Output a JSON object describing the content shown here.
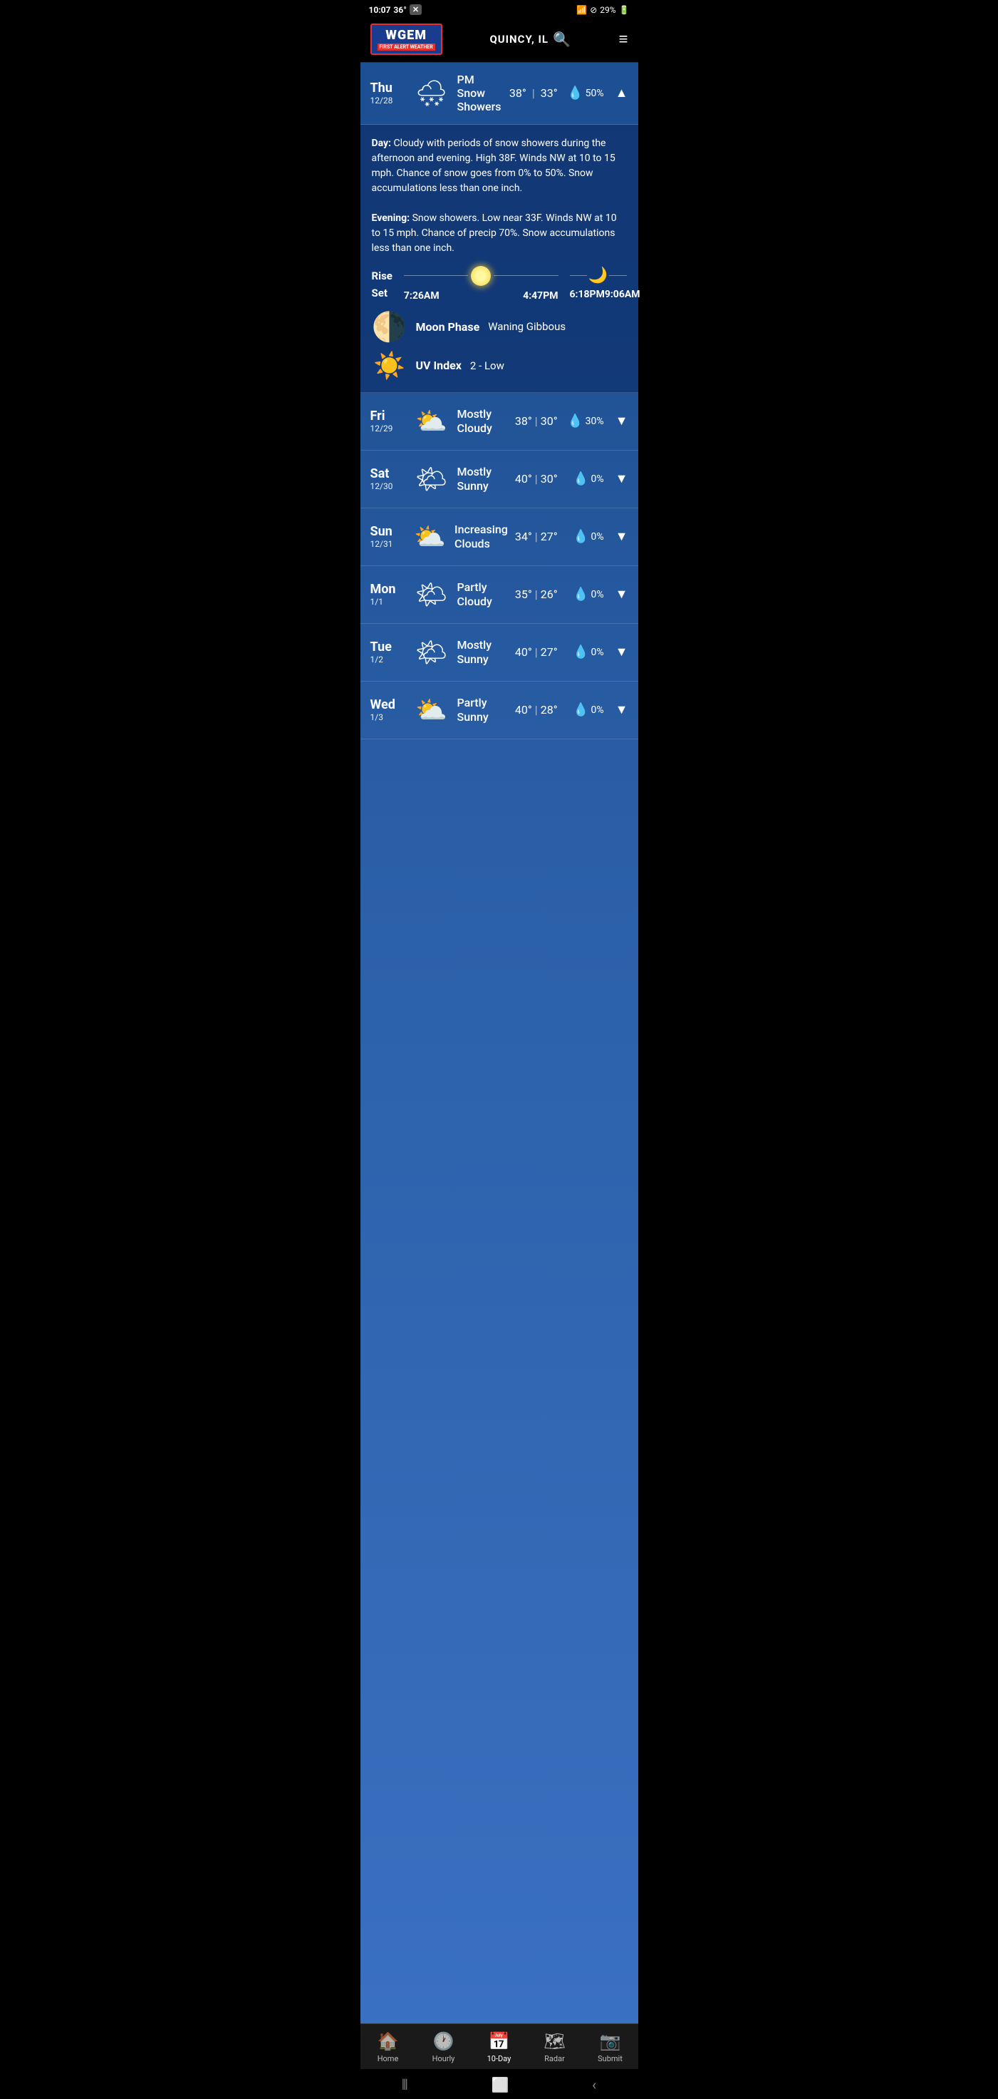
{
  "status": {
    "time": "10:07",
    "temp": "36°",
    "battery": "29%"
  },
  "header": {
    "logo": "WGEM",
    "logo_sub": "FIRST ALERT WEATHER",
    "location": "QUINCY, IL",
    "menu_icon": "≡"
  },
  "expanded_day": {
    "day_name": "Thu",
    "day_date": "12/28",
    "condition": "PM Snow Showers",
    "high": "38°",
    "low": "33°",
    "precip": "50%",
    "icon": "🌨",
    "chevron": "▲",
    "detail": {
      "day_text": "Day: Cloudy with periods of snow showers during the afternoon and evening. High 38F. Winds NW at 10 to 15 mph. Chance of snow goes from 0% to 50%. Snow accumulations less than one inch.",
      "evening_text": "Evening: Snow showers. Low near 33F. Winds NW at 10 to 15 mph. Chance of precip 70%. Snow accumulations less than one inch.",
      "sunrise": "7:26AM",
      "sunset": "4:47PM",
      "moonrise": "6:18PM",
      "moonset": "9:06AM",
      "rise_label": "Rise",
      "set_label": "Set",
      "moon_phase_label": "Moon Phase",
      "moon_phase_value": "Waning Gibbous",
      "uv_label": "UV Index",
      "uv_value": "2 - Low"
    }
  },
  "forecast": [
    {
      "day_name": "Fri",
      "day_date": "12/29",
      "condition": "Mostly Cloudy",
      "high": "38°",
      "low": "30°",
      "precip": "30%",
      "icon": "⛅",
      "chevron": "▼"
    },
    {
      "day_name": "Sat",
      "day_date": "12/30",
      "condition": "Mostly Sunny",
      "high": "40°",
      "low": "30°",
      "precip": "0%",
      "icon": "🌤",
      "chevron": "▼"
    },
    {
      "day_name": "Sun",
      "day_date": "12/31",
      "condition": "Increasing Clouds",
      "high": "34°",
      "low": "27°",
      "precip": "0%",
      "icon": "⛅",
      "chevron": "▼"
    },
    {
      "day_name": "Mon",
      "day_date": "1/1",
      "condition": "Partly Cloudy",
      "high": "35°",
      "low": "26°",
      "precip": "0%",
      "icon": "🌤",
      "chevron": "▼"
    },
    {
      "day_name": "Tue",
      "day_date": "1/2",
      "condition": "Mostly Sunny",
      "high": "40°",
      "low": "27°",
      "precip": "0%",
      "icon": "🌤",
      "chevron": "▼"
    },
    {
      "day_name": "Wed",
      "day_date": "1/3",
      "condition": "Partly Sunny",
      "high": "40°",
      "low": "28°",
      "precip": "0%",
      "icon": "⛅",
      "chevron": "▼"
    }
  ],
  "bottom_nav": [
    {
      "id": "home",
      "label": "Home",
      "icon": "🏠",
      "active": false
    },
    {
      "id": "hourly",
      "label": "Hourly",
      "icon": "🕐",
      "active": false
    },
    {
      "id": "ten-day",
      "label": "10-Day",
      "icon": "📅",
      "active": true
    },
    {
      "id": "radar",
      "label": "Radar",
      "icon": "🗺",
      "active": false
    },
    {
      "id": "submit",
      "label": "Submit",
      "icon": "📷",
      "active": false
    }
  ]
}
